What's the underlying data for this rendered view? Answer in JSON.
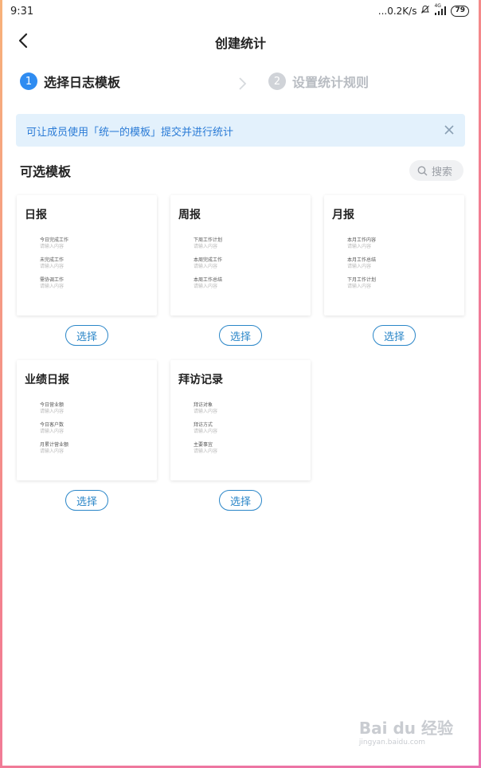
{
  "status_bar": {
    "time": "9:31",
    "network_speed": "...0.2K/s",
    "signal_label": "4G",
    "battery": "79"
  },
  "header": {
    "title": "创建统计"
  },
  "steps": [
    {
      "number": "1",
      "label": "选择日志模板",
      "active": true
    },
    {
      "number": "2",
      "label": "设置统计规则",
      "active": false
    }
  ],
  "notice": {
    "text": "可让成员使用「统一的模板」提交并进行统计"
  },
  "section": {
    "title": "可选模板"
  },
  "search": {
    "placeholder": "搜索"
  },
  "choose_label": "选择",
  "templates": [
    {
      "title": "日报",
      "fields": [
        {
          "label": "今日完成工作",
          "placeholder": "请输入内容"
        },
        {
          "label": "未完成工作",
          "placeholder": "请输入内容"
        },
        {
          "label": "需协调工作",
          "placeholder": "请输入内容"
        }
      ]
    },
    {
      "title": "周报",
      "fields": [
        {
          "label": "下周工作计划",
          "placeholder": "请输入内容"
        },
        {
          "label": "本周完成工作",
          "placeholder": "请输入内容"
        },
        {
          "label": "本周工作总结",
          "placeholder": "请输入内容"
        }
      ]
    },
    {
      "title": "月报",
      "fields": [
        {
          "label": "本月工作内容",
          "placeholder": "请输入内容"
        },
        {
          "label": "本月工作总结",
          "placeholder": "请输入内容"
        },
        {
          "label": "下月工作计划",
          "placeholder": "请输入内容"
        }
      ]
    },
    {
      "title": "业绩日报",
      "fields": [
        {
          "label": "今日营业额",
          "placeholder": "请输入内容"
        },
        {
          "label": "今日客户数",
          "placeholder": "请输入内容"
        },
        {
          "label": "月累计营业额",
          "placeholder": "请输入内容"
        }
      ]
    },
    {
      "title": "拜访记录",
      "fields": [
        {
          "label": "拜访对象",
          "placeholder": "请输入内容"
        },
        {
          "label": "拜访方式",
          "placeholder": "请输入内容"
        },
        {
          "label": "主要事宜",
          "placeholder": "请输入内容"
        }
      ]
    }
  ],
  "watermark": {
    "text": "Bai du 经验",
    "subtext": "jingyan.baidu.com"
  },
  "colors": {
    "accent": "#2f8cf1",
    "button_border": "#2a86c8",
    "notice_bg": "#e3f1fc",
    "notice_text": "#2a7bd6"
  }
}
